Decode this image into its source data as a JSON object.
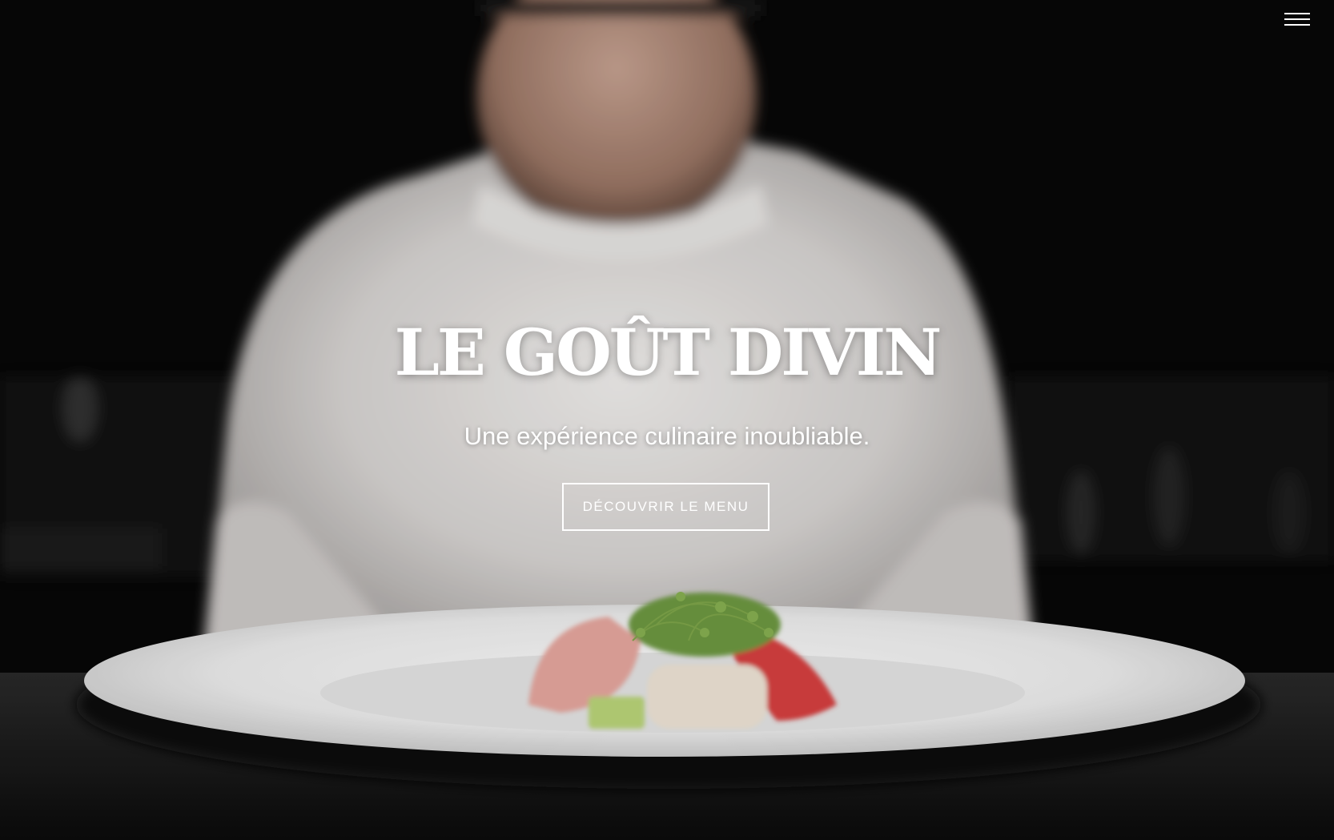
{
  "navigation": {
    "menu_icon": "hamburger-menu-icon"
  },
  "hero": {
    "title": "LE GOÛT DIVIN",
    "tagline": "Une expérience culinaire inoubliable.",
    "cta_label": "DÉCOUVRIR LE MENU",
    "background_image": "chef plating a dish of fish slices with microgreens on a white plate"
  },
  "colors": {
    "text": "#ffffff",
    "background": "#050505",
    "button_border": "#ffffff"
  }
}
